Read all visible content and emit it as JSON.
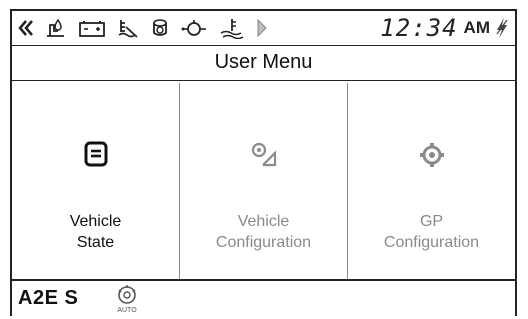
{
  "status_bar": {
    "icons": [
      "chevron-left-icon",
      "water-in-fuel-icon",
      "battery-icon",
      "coolant-level-icon",
      "air-filter-icon",
      "engine-icon",
      "coolant-temp-icon",
      "chevron-right-icon"
    ],
    "time": "12:34",
    "am_pm": "AM",
    "bolt_icon": "lightning-icon"
  },
  "title": "User Menu",
  "tiles": [
    {
      "label": "Vehicle\nState",
      "icon": "document-icon",
      "enabled": true
    },
    {
      "label": "Vehicle\nConfiguration",
      "icon": "vehicle-config-icon",
      "enabled": false
    },
    {
      "label": "GP\nConfiguration",
      "icon": "gear-icon",
      "enabled": false
    }
  ],
  "footer": {
    "mode": "A2E S",
    "auto_icon": "auto-gear-icon",
    "auto_text": "AUTO"
  },
  "colors": {
    "text": "#111111",
    "disabled": "#8a8a8a",
    "border": "#222222"
  }
}
